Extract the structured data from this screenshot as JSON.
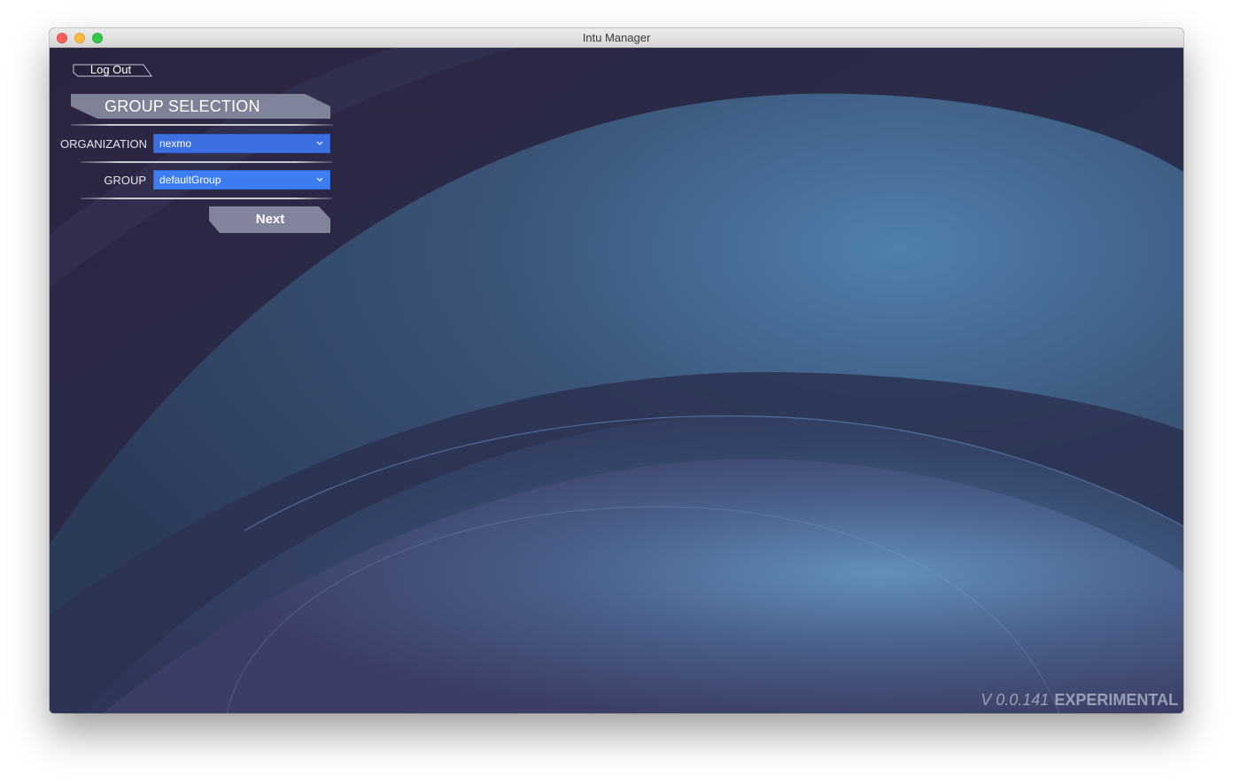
{
  "window": {
    "title": "Intu Manager"
  },
  "toolbar": {
    "logout_label": "Log Out"
  },
  "group_selection": {
    "heading": "GROUP SELECTION",
    "organization": {
      "label": "ORGANIZATION",
      "value": "nexmo"
    },
    "group": {
      "label": "GROUP",
      "value": "defaultGroup"
    },
    "next_label": "Next"
  },
  "footer": {
    "version": "V 0.0.141",
    "build": "EXPERIMENTAL"
  },
  "colors": {
    "select_blue": "#3c6fe0",
    "select_blue_active": "#3d7df1",
    "background_dark": "#2a2f4a",
    "background_light_blue": "#5a8ab5"
  },
  "icons": {
    "close": "close-icon",
    "minimize": "minimize-icon",
    "maximize": "maximize-icon",
    "dropdown": "chevron-down-icon"
  }
}
